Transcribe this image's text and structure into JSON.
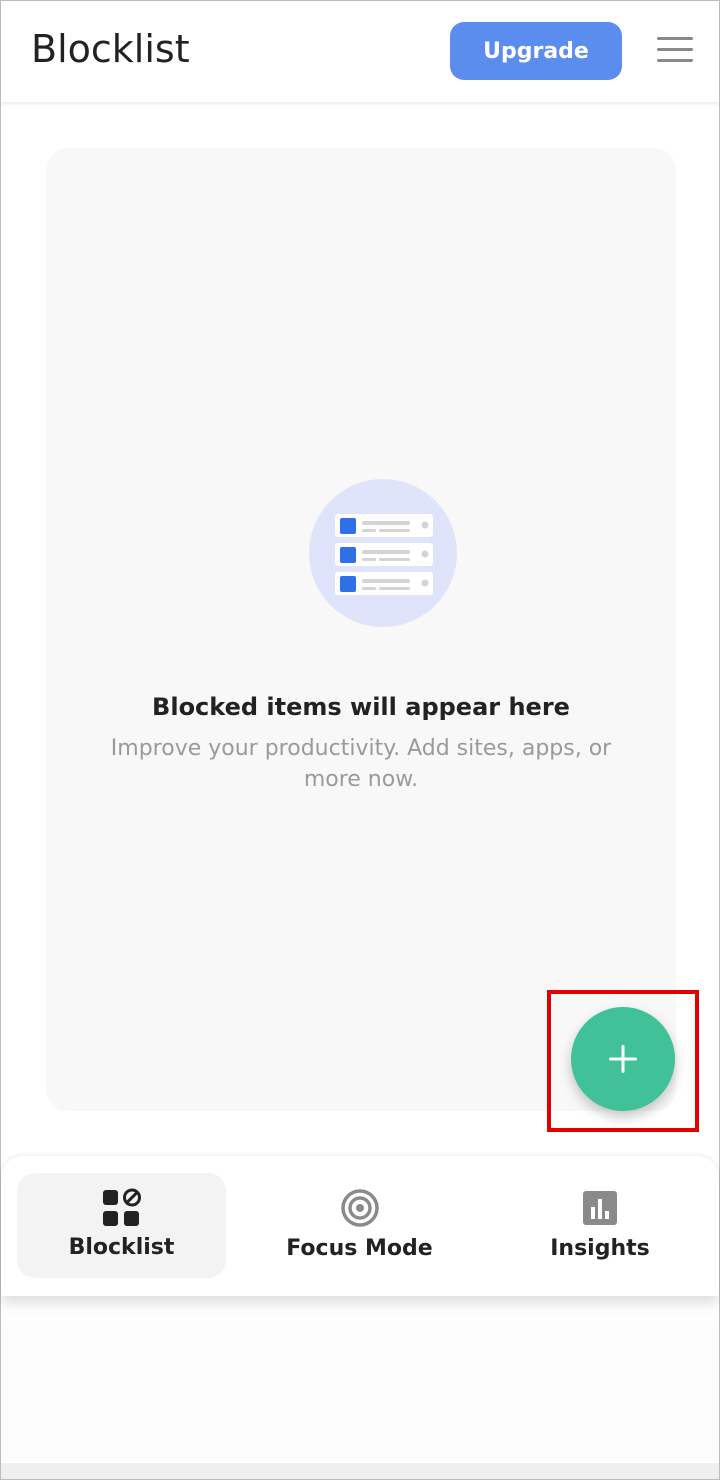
{
  "header": {
    "title": "Blocklist",
    "upgrade_label": "Upgrade",
    "menu_icon": "hamburger-menu-icon"
  },
  "empty_state": {
    "title": "Blocked items will appear here",
    "subtitle": "Improve your productivity. Add sites, apps, or more now.",
    "illustration": "blocklist-illustration"
  },
  "fab": {
    "icon": "plus-icon"
  },
  "bottom_nav": {
    "items": [
      {
        "label": "Blocklist",
        "icon": "blocklist-icon",
        "active": true
      },
      {
        "label": "Focus Mode",
        "icon": "focus-target-icon",
        "active": false
      },
      {
        "label": "Insights",
        "icon": "bar-chart-icon",
        "active": false
      }
    ]
  },
  "colors": {
    "accent_blue": "#5b8def",
    "fab_green": "#40c197",
    "highlight_red": "#e30000"
  }
}
